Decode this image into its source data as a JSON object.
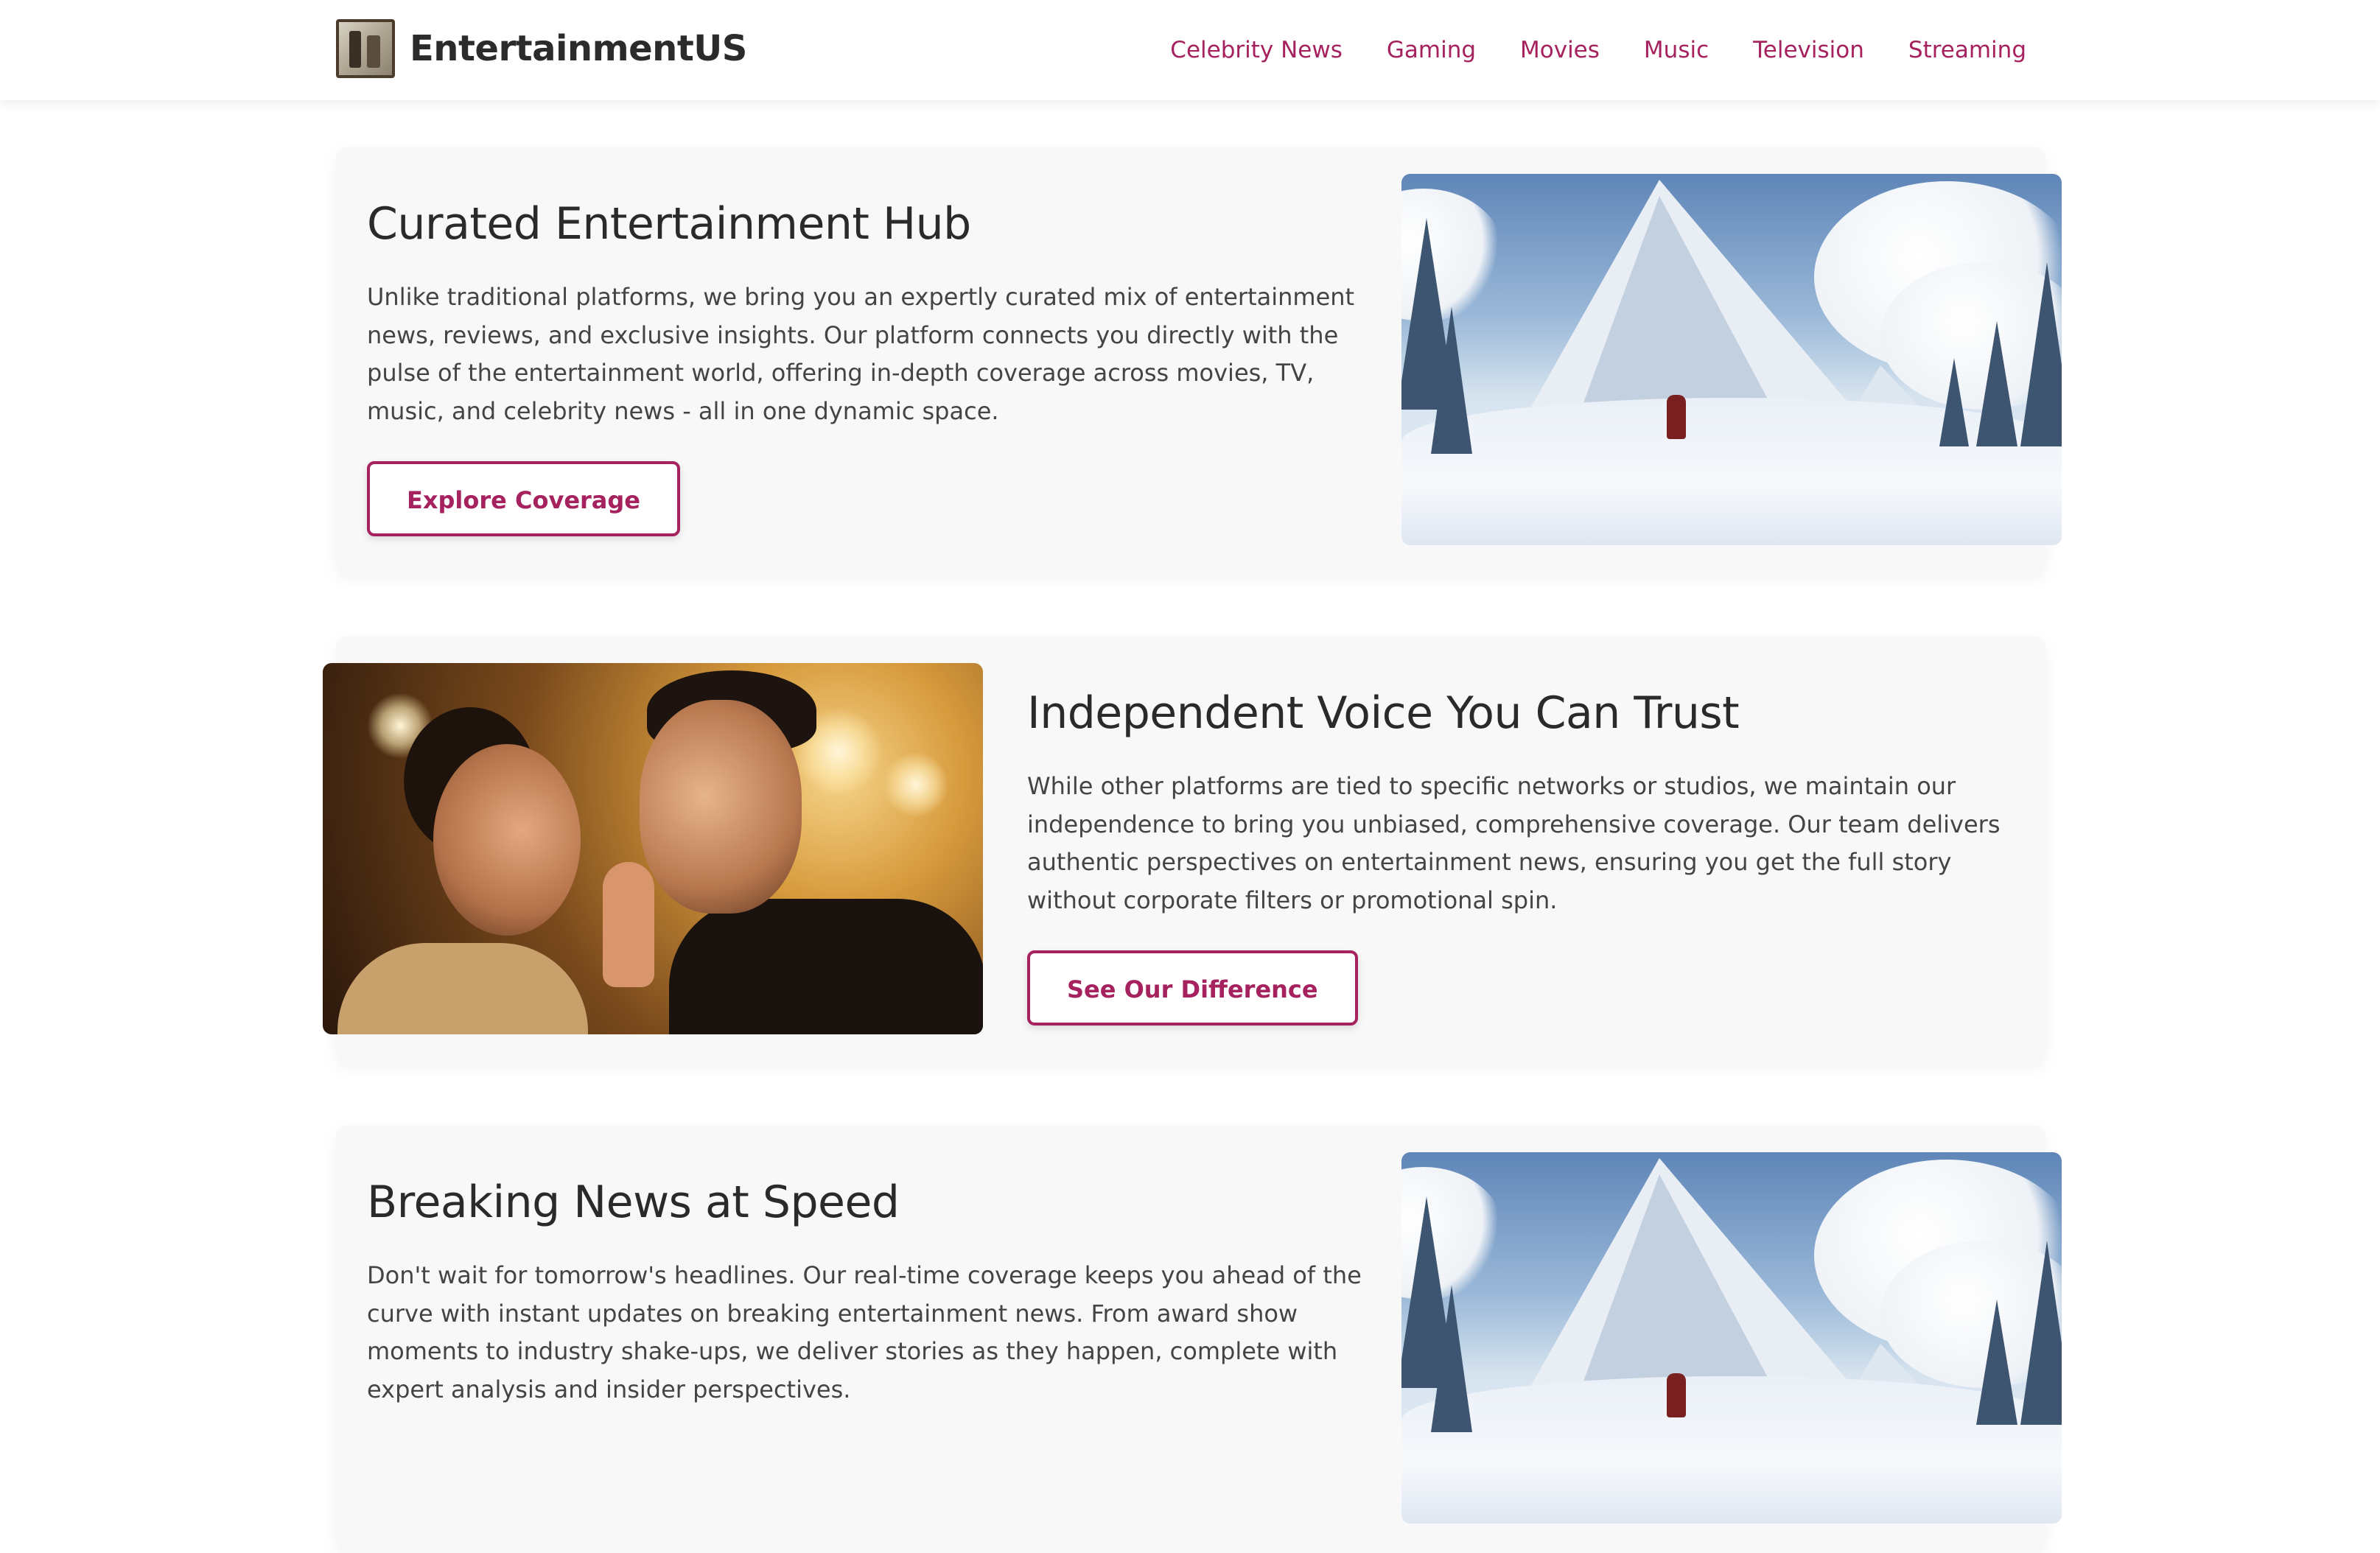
{
  "header": {
    "brand": "EntertainmentUS",
    "nav": [
      {
        "label": "Celebrity News"
      },
      {
        "label": "Gaming"
      },
      {
        "label": "Movies"
      },
      {
        "label": "Music"
      },
      {
        "label": "Television"
      },
      {
        "label": "Streaming"
      }
    ]
  },
  "features": [
    {
      "title": "Curated Entertainment Hub",
      "description": "Unlike traditional platforms, we bring you an expertly curated mix of entertainment news, reviews, and exclusive insights. Our platform connects you directly with the pulse of the entertainment world, offering in-depth coverage across movies, TV, music, and celebrity news - all in one dynamic space.",
      "button": "Explore Coverage"
    },
    {
      "title": "Independent Voice You Can Trust",
      "description": "While other platforms are tied to specific networks or studios, we maintain our independence to bring you unbiased, comprehensive coverage. Our team delivers authentic perspectives on entertainment news, ensuring you get the full story without corporate filters or promotional spin.",
      "button": "See Our Difference"
    },
    {
      "title": "Breaking News at Speed",
      "description": "Don't wait for tomorrow's headlines. Our real-time coverage keeps you ahead of the curve with instant updates on breaking entertainment news. From award show moments to industry shake-ups, we deliver stories as they happen, complete with expert analysis and insider perspectives.",
      "button": ""
    }
  ],
  "colors": {
    "accent": "#a5225f",
    "heading": "#2a2a2a",
    "body_text": "#444444",
    "card_background": "#f8f8f8"
  }
}
